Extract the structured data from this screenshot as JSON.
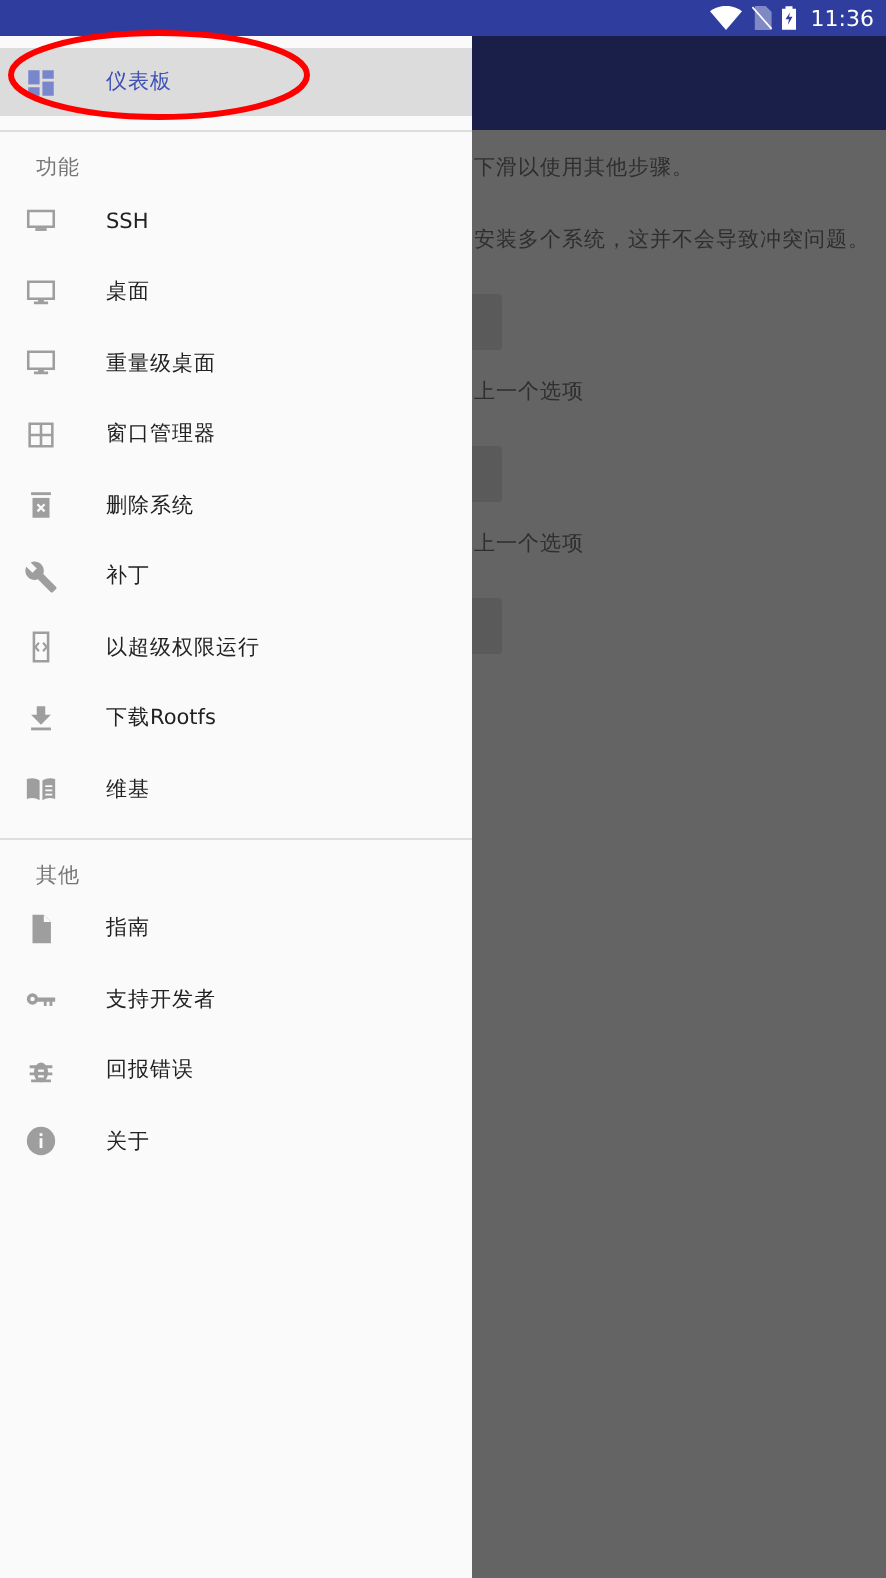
{
  "status_bar": {
    "time": "11:36"
  },
  "background": {
    "lines": [
      {
        "kind": "text",
        "text": "下滑以使用其他步骤。"
      },
      {
        "kind": "text",
        "text": "安装多个系统，这并不会导致冲突问题。"
      },
      {
        "kind": "button"
      },
      {
        "kind": "text",
        "text": "上一个选项"
      },
      {
        "kind": "button"
      },
      {
        "kind": "text",
        "text": "上一个选项"
      },
      {
        "kind": "button"
      }
    ]
  },
  "drawer": {
    "top_items": [
      {
        "label": "仪表板",
        "selected": true
      }
    ],
    "sections": [
      {
        "title": "功能",
        "items": [
          {
            "label": "SSH",
            "selected": false
          },
          {
            "label": "桌面",
            "selected": false
          },
          {
            "label": "重量级桌面",
            "selected": false
          },
          {
            "label": "窗口管理器",
            "selected": false
          },
          {
            "label": "删除系统",
            "selected": false
          },
          {
            "label": "补丁",
            "selected": false
          },
          {
            "label": "以超级权限运行",
            "selected": false
          },
          {
            "label": "下载Rootfs",
            "selected": false
          },
          {
            "label": "维基",
            "selected": false
          }
        ]
      },
      {
        "title": "其他",
        "items": [
          {
            "label": "指南",
            "selected": false
          },
          {
            "label": "支持开发者",
            "selected": false
          },
          {
            "label": "回报错误",
            "selected": false
          },
          {
            "label": "关于",
            "selected": false
          }
        ]
      }
    ]
  },
  "annotation": {
    "kind": "ellipse",
    "color": "#ff0000"
  }
}
